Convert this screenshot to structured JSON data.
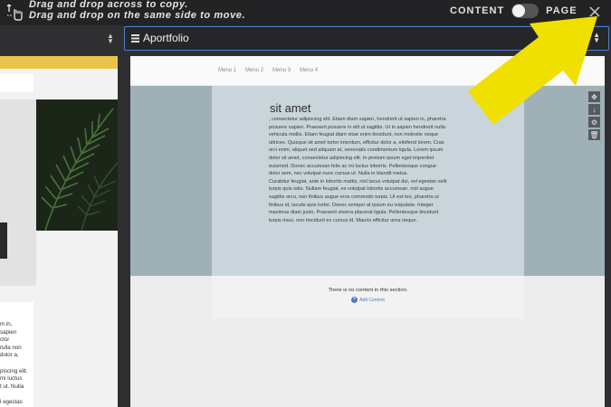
{
  "topbar": {
    "instruction_line1": "Drag and drop across to copy.",
    "instruction_line2": "Drag and drop on the same side to move.",
    "toggle_left_label": "CONTENT",
    "toggle_right_label": "PAGE",
    "icons": {
      "drag": "drag-move-icon",
      "close": "close-icon"
    }
  },
  "selectors": {
    "left_value": "",
    "right_value": "Aportfolio",
    "right_icon": "list-icon"
  },
  "left_preview": {
    "text_lines": [
      "m in,",
      "sapien",
      "ctor",
      "rulla non",
      "dolor a,",
      "",
      "piscing elit.",
      "mi luctus",
      "t ut. Nulla",
      "",
      "l egestas"
    ]
  },
  "right_preview": {
    "menu": [
      "Menu 1",
      "Menu 2",
      "Menu 3",
      "Menu 4"
    ],
    "section_title": "sit amet",
    "body_lines": [
      ", consectetur adipiscing elit. Etiam diam sapien, hendrerit ut sapien in, pharetra",
      "posuere sapien. Praesent posuere in elit ut sagittis. Ut in sapien hendrerit nulla",
      "vehicula mollis. Etiam feugiat diam vitae enim tincidunt, non molestie neque",
      "ultrices. Quisque sit amet tortor interdum, efficitur dolor a, eleifend lorem. Cras",
      "orci enim, aliquet sed aliquam at, venenatis condimentum ligula. Lorem ipsum",
      "dolor sit amet, consectetur adipiscing elit. In pretium ipsum eget imperdiet",
      "euismod. Donec accumsan felis ac mi luctus lobortis. Pellentesque congue",
      "dolor sem, nec volutpat nunc cursus ut. Nulla in blandit metus.",
      "Curabitur feugiat, ante in lobortis mattis, nisl lacus volutpat dui, vel egestas velit",
      "turpis quis odio. Nullam feugiat, ex volutpat lobortis accumsan, nisl augue",
      "sagittis arcu, non finibus augue eros commodo turpis. Ut est leo, pharetra ut",
      "finibus id, iaculis quis tortor. Donec semper at ipsum eu vulputate. Integer",
      "maximus diam justo. Praesent viverra placerat ligula. Pellentesque tincidunt",
      "turpis risus, non tincidunt ex cursus id. Mauris efficitur urna neque."
    ],
    "empty_note": "There is no content in this section.",
    "add_content": "Add Content",
    "tool_icons": [
      "move-icon",
      "arrow-down-icon",
      "gear-icon",
      "trash-icon"
    ]
  },
  "colors": {
    "accent_blue": "#4b80d6",
    "arrow_yellow": "#f0e000",
    "hero_teal": "#9fb1b7",
    "left_yellow": "#e9c44a"
  }
}
